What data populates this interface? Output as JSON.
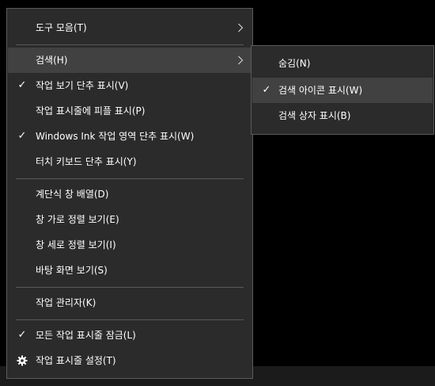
{
  "context_menu": {
    "items": [
      {
        "label": "도구 모음(T)",
        "checked": false,
        "has_submenu": true
      },
      {
        "label": "검색(H)",
        "checked": false,
        "has_submenu": true,
        "highlighted": true
      },
      {
        "label": "작업 보기 단추 표시(V)",
        "checked": true
      },
      {
        "label": "작업 표시줄에 피플 표시(P)",
        "checked": false
      },
      {
        "label": "Windows Ink 작업 영역 단추 표시(W)",
        "checked": true
      },
      {
        "label": "터치 키보드 단추 표시(Y)",
        "checked": false
      },
      {
        "label": "계단식 창 배열(D)",
        "checked": false
      },
      {
        "label": "창 가로 정렬 보기(E)",
        "checked": false
      },
      {
        "label": "창 세로 정렬 보기(I)",
        "checked": false
      },
      {
        "label": "바탕 화면 보기(S)",
        "checked": false
      },
      {
        "label": "작업 관리자(K)",
        "checked": false
      },
      {
        "label": "모든 작업 표시줄 잠금(L)",
        "checked": true
      },
      {
        "label": "작업 표시줄 설정(T)",
        "icon": "gear-icon"
      }
    ],
    "check_glyph": "✓"
  },
  "search_submenu": {
    "items": [
      {
        "label": "숨김(N)",
        "checked": false
      },
      {
        "label": "검색 아이콘 표시(W)",
        "checked": true,
        "highlighted": true
      },
      {
        "label": "검색 상자 표시(B)",
        "checked": false
      }
    ]
  },
  "colors": {
    "menu_bg": "#2b2b2b",
    "highlight_bg": "#414141",
    "border": "#5a5a5a",
    "text": "#ffffff"
  }
}
